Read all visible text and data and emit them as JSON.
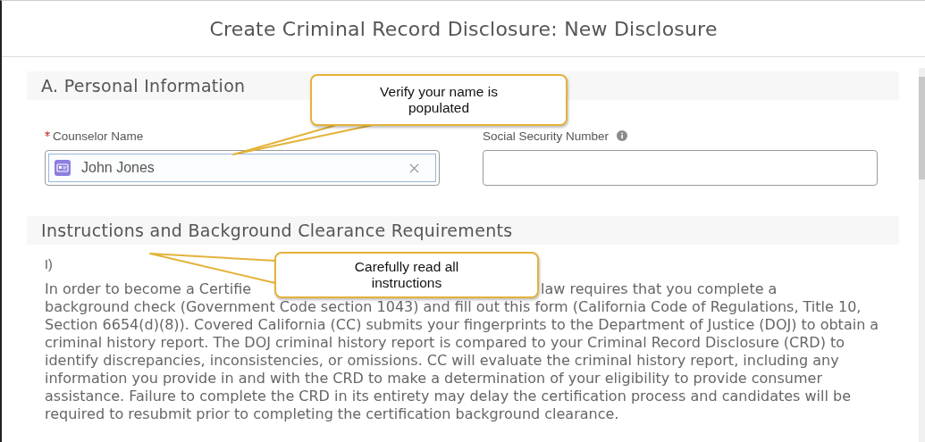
{
  "window": {
    "title": "Create Criminal Record Disclosure: New Disclosure"
  },
  "personal_information": {
    "heading": "A. Personal Information",
    "fields": [
      {
        "kind": "lookup",
        "label": "Counselor Name",
        "required": true,
        "info": false,
        "value": "John Jones",
        "focused": true
      },
      {
        "kind": "text",
        "label": "Social Security Number",
        "required": false,
        "info": true,
        "focused": false
      }
    ]
  },
  "instructions": {
    "heading": "Instructions and Background Clearance Requirements",
    "item_label": "I)",
    "paragraph_start": "In order to become a Certifie",
    "paragraph_after_callout": "law requires that you complete a",
    "paragraph_rest": "background check (Government Code section 1043) and fill out this form (California Code of Regulations, Title 10, Section 6654(d)(8)). Covered California (CC) submits your fingerprints to the Department of Justice (DOJ) to obtain a criminal history report. The DOJ criminal history report is compared to your Criminal Record Disclosure (CRD) to identify discrepancies, inconsistencies, or omissions. CC will evaluate the criminal history report, including any information you provide in and with the CRD to make a determination of your eligibility to provide consumer assistance. Failure to complete the CRD in its entirety may delay the certification process and candidates will be required to resubmit prior to completing the certification background clearance."
  },
  "callouts": [
    {
      "text": "Verify your name is populated"
    },
    {
      "text": "Carefully read all instructions"
    }
  ]
}
